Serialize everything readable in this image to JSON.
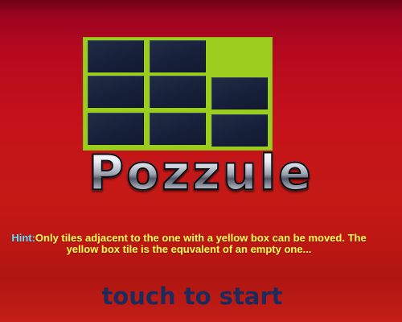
{
  "game": {
    "title": "Pozzule",
    "hint_label": "Hint:",
    "hint_text": "Only tiles adjacent to the one with a yellow box can be moved. The yellow box tile is the equvalent of an empty one...",
    "start_prompt": "touch to start"
  },
  "board": {
    "rows": 3,
    "cols": 3,
    "empty_tile": "row 1, column 3"
  },
  "colors": {
    "background": "#c41a17",
    "board_yellow": "#9acd1e",
    "tile_navy": "#17203a",
    "hint_label": "#5fe0ff",
    "hint_text": "#ffff55",
    "start_text": "#1c2b5c"
  }
}
